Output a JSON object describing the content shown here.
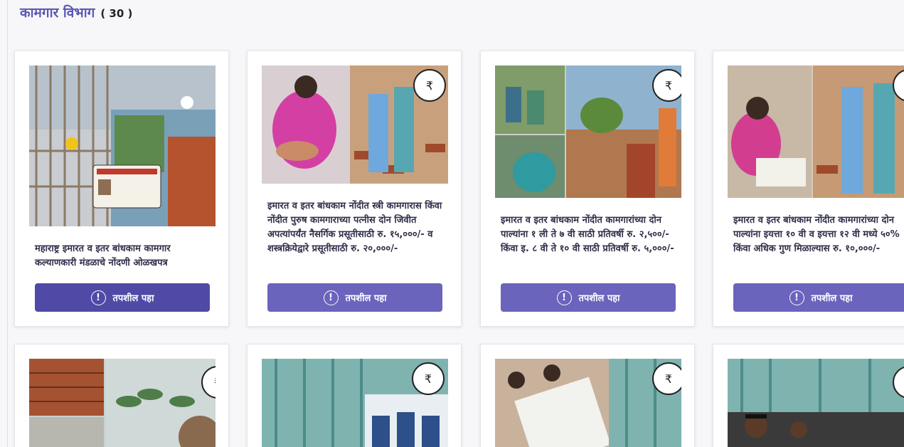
{
  "header": {
    "title": "कामगार विभाग",
    "count": "( 30 )"
  },
  "colors": {
    "accent": "#5b57b3",
    "button_active": "#4f4aa6",
    "button": "#6a64bd"
  },
  "cards": [
    {
      "description": "महाराष्ट्र इमारत व इतर बांधकाम कामगार कल्याणकारी मंडळाचे नोंदणी ओळखपत्र",
      "button_label": "तपशील पहा",
      "image_alt": "registration-id-card-image"
    },
    {
      "description": "इमारत व इतर बांधकाम नोंदीत स्त्री कामगारास किंवा नोंदीत पुरुष कामगाराच्या पत्नीस दोन जिवीत अपत्यांपर्यंत नैसर्गिक प्रसूतीसाठी रु. १५,०००/- व शस्त्रक्रियेद्वारे प्रसूतीसाठी रु. २०,०००/-",
      "button_label": "तपशील पहा",
      "image_alt": "maternity-benefit-image"
    },
    {
      "description": "इमारत व इतर बांधकाम नोंदीत कामगारांच्या दोन पाल्यांना १ ली ते ७ वी साठी प्रतिवर्षी रु. २,५००/- किंवा इ. ८ वी ते १० वी साठी प्रतिवर्षी रु. ५,०००/-",
      "button_label": "तपशील पहा",
      "image_alt": "school-education-image"
    },
    {
      "description": "इमारत व इतर बांधकाम नोंदीत कामगारांच्या दोन पाल्यांना इयत्ता १० वी व इयत्ता १२ वी मध्ये ५०% किंवा अधिक गुण मिळाल्यास रु. १०,०००/-",
      "button_label": "तपशील पहा",
      "image_alt": "exam-reward-image"
    }
  ],
  "rupee_symbol": "₹",
  "info_symbol": "!"
}
